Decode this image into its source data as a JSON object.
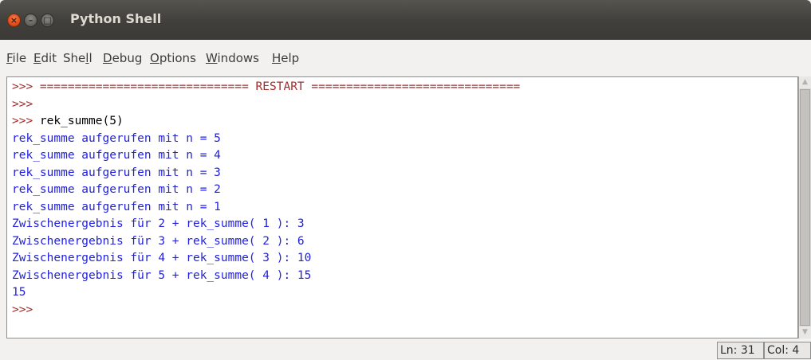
{
  "window": {
    "title": "Python Shell",
    "buttons": {
      "close": "×",
      "minimize": "–",
      "maximize": "□"
    }
  },
  "menu": {
    "items": [
      {
        "label": "File",
        "mnemonic_index": 0
      },
      {
        "label": "Edit",
        "mnemonic_index": 0
      },
      {
        "label": "Shell",
        "mnemonic_index": 3
      },
      {
        "label": "Debug",
        "mnemonic_index": 0
      },
      {
        "label": "Options",
        "mnemonic_index": 0
      },
      {
        "label": "Windows",
        "mnemonic_index": 0
      },
      {
        "label": "Help",
        "mnemonic_index": 0
      }
    ]
  },
  "shell": {
    "lines": [
      {
        "prompt": ">>> ",
        "text": "============================== RESTART ==============================",
        "kind": "prompt"
      },
      {
        "prompt": ">>> ",
        "text": "",
        "kind": "prompt"
      },
      {
        "prompt": ">>> ",
        "text": "rek_summe(5)",
        "kind": "input"
      },
      {
        "prompt": "",
        "text": "rek_summe aufgerufen mit n = 5",
        "kind": "output"
      },
      {
        "prompt": "",
        "text": "rek_summe aufgerufen mit n = 4",
        "kind": "output"
      },
      {
        "prompt": "",
        "text": "rek_summe aufgerufen mit n = 3",
        "kind": "output"
      },
      {
        "prompt": "",
        "text": "rek_summe aufgerufen mit n = 2",
        "kind": "output"
      },
      {
        "prompt": "",
        "text": "rek_summe aufgerufen mit n = 1",
        "kind": "output"
      },
      {
        "prompt": "",
        "text": "Zwischenergebnis für 2 + rek_summe( 1 ): 3",
        "kind": "output"
      },
      {
        "prompt": "",
        "text": "Zwischenergebnis für 3 + rek_summe( 2 ): 6",
        "kind": "output"
      },
      {
        "prompt": "",
        "text": "Zwischenergebnis für 4 + rek_summe( 3 ): 10",
        "kind": "output"
      },
      {
        "prompt": "",
        "text": "Zwischenergebnis für 5 + rek_summe( 4 ): 15",
        "kind": "output"
      },
      {
        "prompt": "",
        "text": "15",
        "kind": "output"
      },
      {
        "prompt": ">>> ",
        "text": "",
        "kind": "prompt"
      }
    ]
  },
  "status": {
    "line": "Ln: 31",
    "col": "Col: 4"
  },
  "colors": {
    "prompt": "#a52a2a",
    "output": "#2222dd",
    "input": "#000000"
  }
}
